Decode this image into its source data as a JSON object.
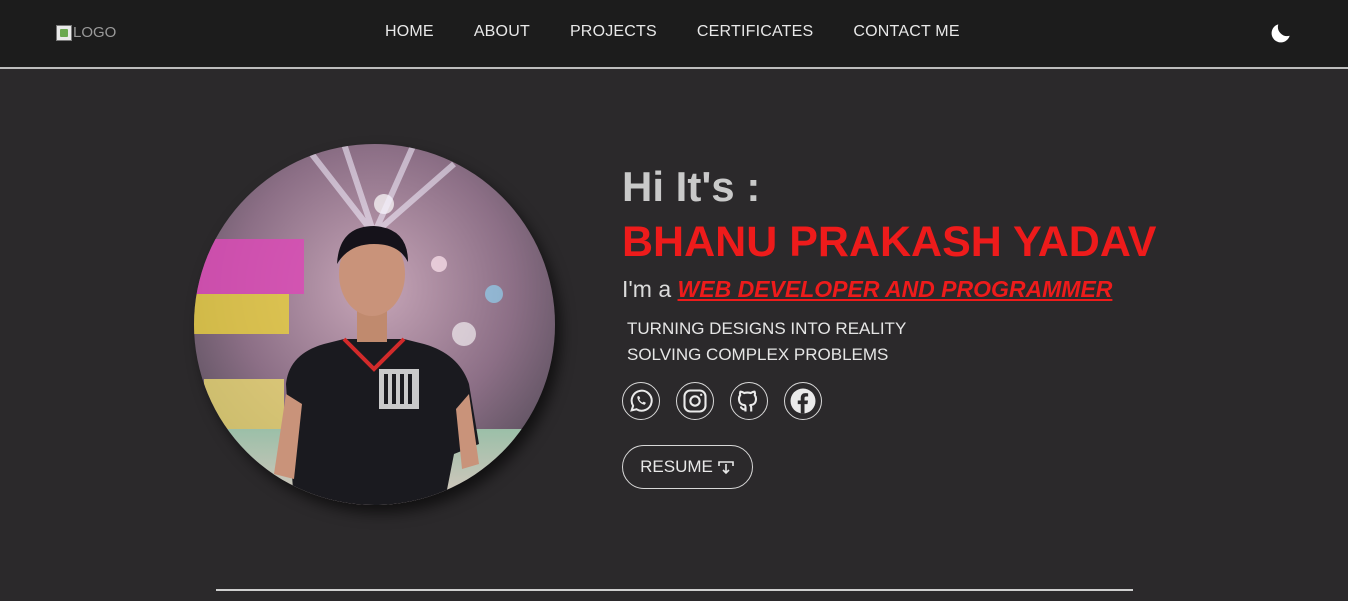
{
  "header": {
    "logo_alt": "LOGO",
    "nav": [
      "HOME",
      "ABOUT",
      "PROJECTS",
      "CERTIFICATES",
      "CONTACT ME"
    ]
  },
  "hero": {
    "greeting": "Hi It's :",
    "name": "BHANU PRAKASH YADAV",
    "role_prefix": "I'm a",
    "role": "WEB DEVELOPER AND PROGRAMMER",
    "taglines": [
      "TURNING DESIGNS INTO REALITY",
      "SOLVING COMPLEX PROBLEMS"
    ],
    "socials": [
      "whatsapp-icon",
      "instagram-icon",
      "github-icon",
      "facebook-icon"
    ],
    "resume_label": "RESUME"
  },
  "colors": {
    "accent": "#ee1b1b",
    "background": "#2b292b",
    "navbar": "#1c1c1c"
  }
}
